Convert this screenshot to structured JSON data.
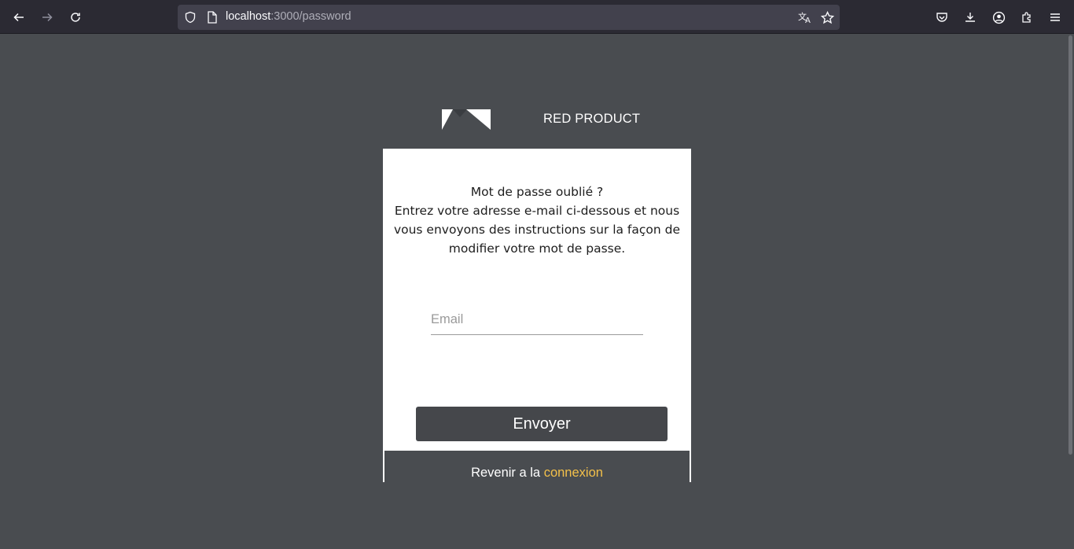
{
  "browser": {
    "url_host": "localhost",
    "url_path": ":3000/password"
  },
  "brand": {
    "name": "RED PRODUCT"
  },
  "card": {
    "heading": "Mot de passe oublié ?",
    "instructions": "Entrez votre adresse e-mail ci-dessous et nous vous envoyons des instructions sur la façon de modifier votre mot de passe.",
    "email_placeholder": "Email",
    "submit_label": "Envoyer"
  },
  "footer": {
    "prefix": "Revenir a la ",
    "link_label": "connexion"
  },
  "colors": {
    "background": "#494c50",
    "card": "#ffffff",
    "button": "#45474b",
    "link": "#f3c04a"
  }
}
